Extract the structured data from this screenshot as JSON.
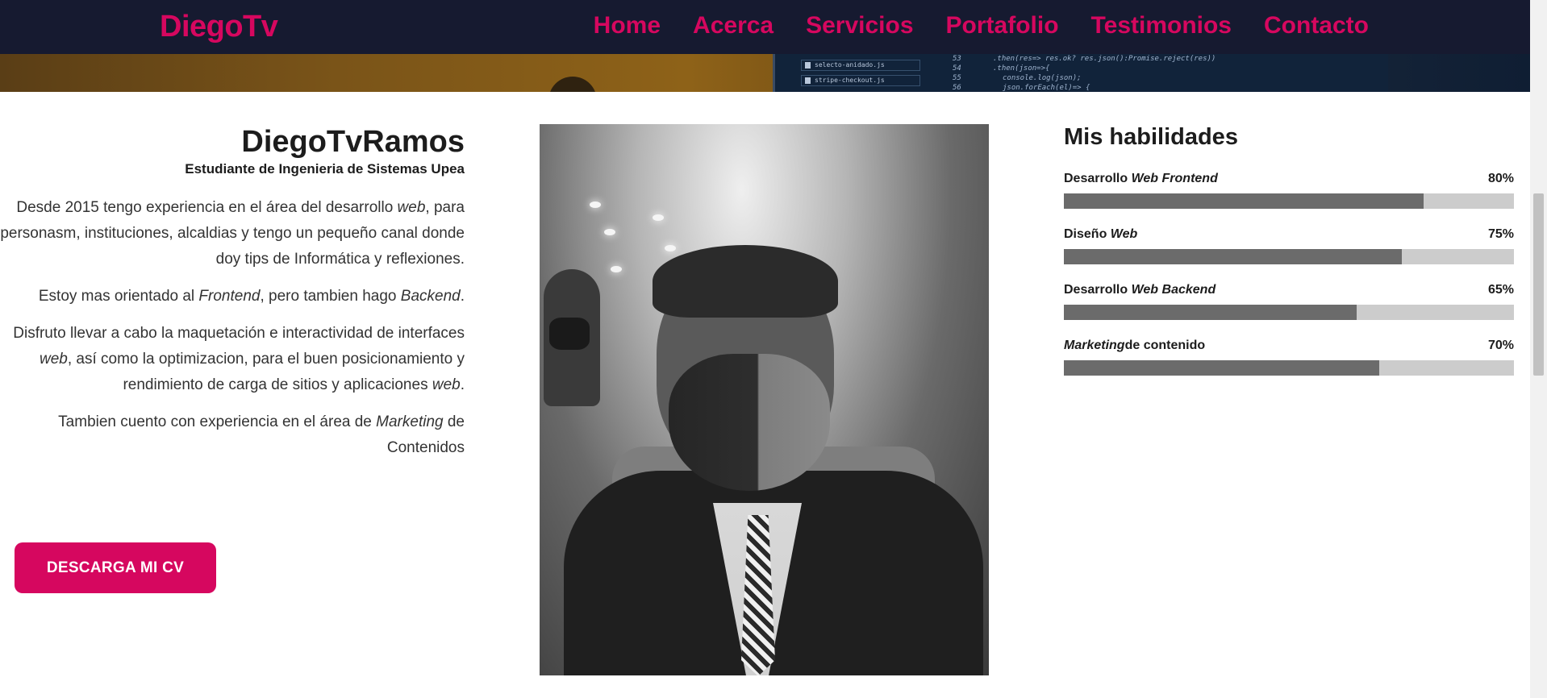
{
  "brand": {
    "name": "DiegoTv",
    "accent_color": "#d6075f",
    "nav_bg_color": "#161a30"
  },
  "nav": {
    "items": [
      {
        "label": "Home"
      },
      {
        "label": "Acerca"
      },
      {
        "label": "Servicios"
      },
      {
        "label": "Portafolio"
      },
      {
        "label": "Testimonios"
      },
      {
        "label": "Contacto"
      }
    ]
  },
  "hero": {
    "code_files": [
      "selecto-anidado.js",
      "stripe-checkout.js"
    ],
    "code_line_numbers": [
      "53",
      "54",
      "55",
      "56"
    ],
    "code_lines": [
      ".then(res=> res.ok? res.json():Promise.reject(res))",
      ".then(json=>{",
      "console.log(json);",
      "json.forEach(el)=> {"
    ]
  },
  "about": {
    "name": "DiegoTvRamos",
    "role": "Estudiante de Ingenieria de Sistemas Upea",
    "p1": [
      "Desde 2015 tengo experiencia en el área del desarrollo ",
      "web",
      ", para personasm, instituciones, alcaldias y tengo un pequeño canal donde doy tips de Informática y reflexiones."
    ],
    "p2": [
      "Estoy mas orientado al ",
      "Frontend",
      ", pero tambien hago ",
      "Backend",
      "."
    ],
    "p3": [
      "Disfruto llevar a cabo la maquetación e interactividad de interfaces ",
      "web",
      ", así como la optimizacion, para el buen posicionamiento y rendimiento de carga de sitios y aplicaciones ",
      "web",
      "."
    ],
    "p4": [
      "Tambien cuento con experiencia en el área de ",
      "Marketing",
      " de Contenidos"
    ],
    "cv_button_label": "DESCARGA MI CV"
  },
  "photo": {
    "description_icon": "profile-photo"
  },
  "skills": {
    "title": "Mis habilidades",
    "items": [
      {
        "prefix": "Desarrollo ",
        "em": "Web Frontend",
        "suffix": "",
        "percent_label": "80%",
        "value": 80
      },
      {
        "prefix": "Diseño ",
        "em": "Web",
        "suffix": "",
        "percent_label": "75%",
        "value": 75
      },
      {
        "prefix": "Desarrollo ",
        "em": "Web Backend",
        "suffix": "",
        "percent_label": "65%",
        "value": 65
      },
      {
        "prefix": "",
        "em": "Marketing",
        "suffix": "de contenido",
        "percent_label": "70%",
        "value": 70
      }
    ]
  }
}
